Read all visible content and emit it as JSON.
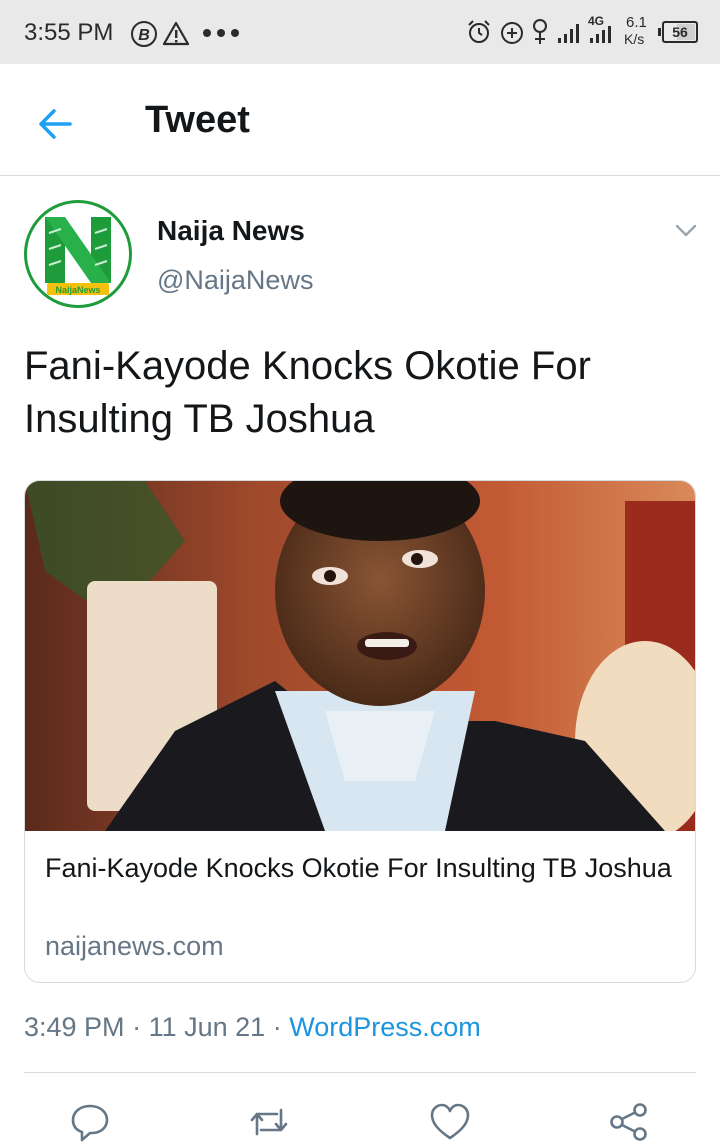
{
  "status_bar": {
    "time": "3:55 PM",
    "network": "4G",
    "speed_value": "6.1",
    "speed_unit": "K/s",
    "battery": "56"
  },
  "header": {
    "back_icon": "arrow-left-icon",
    "title": "Tweet"
  },
  "tweet": {
    "author_name": "Naija News",
    "author_handle": "@NaijaNews",
    "avatar_text": "NaijaNews",
    "text": "Fani-Kayode Knocks Okotie For Insulting TB Joshua",
    "card": {
      "title": "Fani-Kayode Knocks Okotie For Insulting TB Joshua",
      "domain": "naijanews.com"
    },
    "time": "3:49 PM",
    "date": "11 Jun 21",
    "separator": "·",
    "source": "WordPress.com"
  },
  "actions": [
    {
      "name": "reply",
      "icon": "reply-icon"
    },
    {
      "name": "retweet",
      "icon": "retweet-icon"
    },
    {
      "name": "like",
      "icon": "heart-icon"
    },
    {
      "name": "share",
      "icon": "share-icon"
    }
  ],
  "colors": {
    "accent": "#1b95e0",
    "muted": "#657786",
    "brand_green": "#1e9b3a"
  }
}
